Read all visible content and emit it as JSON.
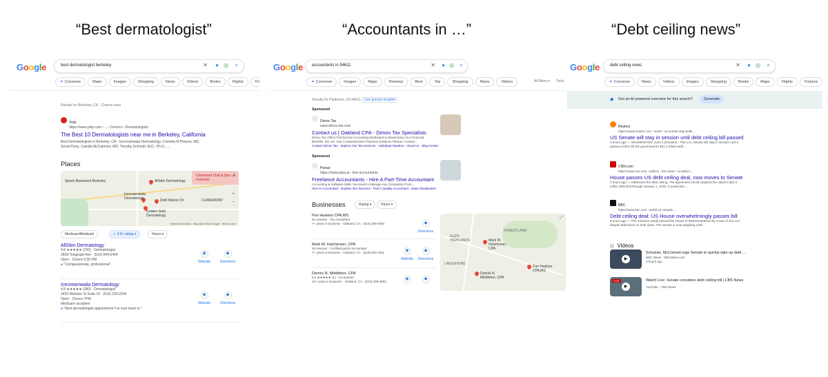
{
  "captions": [
    "“Best dermatologist”",
    "“Accountants in …”",
    "“Debt ceiling news”"
  ],
  "panel1": {
    "query": "best dermatologist berkeley",
    "chips": [
      "Converse",
      "Maps",
      "Images",
      "Shopping",
      "News",
      "Videos",
      "Books",
      "Flights",
      "Finance"
    ],
    "results_for": "Results for Berkeley, CA · Choose area",
    "yelp_source": "Yelp",
    "yelp_url": "https://www.yelp.com › ... › Doctors › Dermatologists",
    "yelp_title": "The Best 10 Dermatologists near me in Berkeley, California",
    "yelp_snippet1": "Best Dermatologists in Berkeley, CA - Icecreamwala Dermatology, Cornelia M Pessoa, MD,",
    "yelp_snippet2": "SevenThirty, Camilla McCalmont, MD, Timothy Schmidt, M.D., Ph.D., ...",
    "places_heading": "Places",
    "map_labels": [
      "AllSkin Dermatology",
      "Icecreamwala Dermatology",
      "Golden Gate Dermatology",
      "Dotti Warren Dr",
      "CLAREMONT",
      "Sports Basement Berkeley",
      "Claremont Club & Spa - A Fairmont"
    ],
    "map_footer": "Keyboard shortcuts · Map data ©2023 Google · Terms of Use",
    "filters": [
      "Medicare/Medicaid",
      "4.0+ rating",
      "Hours"
    ],
    "listings": [
      {
        "name": "AllSkin Dermatology",
        "rating": "4.8 ★★★★★ (242) · Dermatologist",
        "address": "2828 Telegraph Ave · (510) 849-6404",
        "hours": "Open · Closes 5:30 PM",
        "review": "\"Compassionate, professional\""
      },
      {
        "name": "Icecreamwala Dermatology",
        "rating": "4.8 ★★★★★ (380) · Dermatologist",
        "address": "2435 Webster St Suite 10 · (510) 330-2264",
        "hours": "Open · Closes 7PM",
        "extra": "Medicare accepted",
        "review": "\"Best dermatologist appointment I've ever been to.\""
      }
    ],
    "website": "Website",
    "directions": "Directions"
  },
  "panel2": {
    "query": "accountants in 94611",
    "chips": [
      "Converse",
      "Images",
      "Maps",
      "Reviews",
      "Best",
      "Top",
      "Shopping",
      "News",
      "Videos"
    ],
    "all_filters": "All filters ▾",
    "tools": "Tools",
    "results_for": "Results for Piedmont, CA 94611",
    "precise": "Use precise location",
    "ads": [
      {
        "sponsored": "Sponsored",
        "source": "Dimov Tax",
        "url": "www.dimov-tax.com",
        "title": "Contact us | Oakland CPA - Dimov Tax Specialists",
        "s1": "Dimov Tax Offers Full-Service Accounting Dedicated to Maximizing Your Financial",
        "s2": "Benefits. We Are Your Comprehensive Financial Solutions Partner. Contact...",
        "links": "Contact Dimov Tax · Explore Our Tax Services · Individual Taxation · About Us · Blog Center"
      },
      {
        "sponsored": "Sponsored",
        "source": "Paraul",
        "url": "https://www.para.ai › hire-accountants",
        "title": "Freelance Accountants - Hire A Part-Time Accountant",
        "s1": "Accounting & Software Skills You Need to Manage Any Complexity From...",
        "s2": "",
        "links": "Hire An Accountant · Explore Our Services · Find A Quality Accountant · Data Visualization"
      }
    ],
    "businesses_heading": "Businesses",
    "filters": [
      "Rating ▾",
      "Hours ▾"
    ],
    "businesses": [
      {
        "name": "Pan Haskins CPA,MS",
        "l1": "No reviews · Tax consultant",
        "l2": "7+ years in business · Oakland, CA · (510) 339-3000"
      },
      {
        "name": "Mark W. Hutchinson, CPA",
        "l1": "No reviews · Certified public accountant",
        "l2": "7+ years in business · Oakland, CA · (510) 653-7911"
      },
      {
        "name": "Dennis N. Middleton, CPA",
        "l1": "5.0 ★★★★★ (1) · Accountant",
        "l2": "10+ years in business · Oakland, CA · (510) 339-4863"
      }
    ],
    "map_labels": [
      "Mark W. Hutchinson, CPA",
      "Pan Haskins CPA,MS",
      "Dennis N. Middleton, CPA",
      "FORESTLAND",
      "GLEN HIGHLANDS",
      "LAKESHORE"
    ],
    "website": "Website",
    "directions": "Directions"
  },
  "panel3": {
    "query": "debt ceiling news",
    "chips": [
      "Converse",
      "News",
      "Videos",
      "Images",
      "Shopping",
      "Books",
      "Maps",
      "Flights",
      "Finance"
    ],
    "sge_prompt": "Get an AI-powered overview for this search?",
    "generate": "Generate",
    "news": [
      {
        "source": "Reuters",
        "url": "https://www.reuters.com › world › us-senate-stay-publi...",
        "title": "US Senate will stay in session until debt ceiling bill passed",
        "s1": "3 hours ago — WASHINGTON, June 1 (Reuters) - The U.S. Senate will stay in session until it",
        "s2": "passes a bill to lift the government's $31.4 trillion debt ..."
      },
      {
        "source": "CNN.com",
        "url": "https://www.cnn.com › politics › live-news › us-debt-c...",
        "title": "House passes US debt ceiling deal, now moves to Senate",
        "s1": "3 hours ago — Addresses the debt ceiling. The agreement would suspend the nation's $31.4",
        "s2": "trillion debt limit through January 1, 2025. It would also ..."
      },
      {
        "source": "BBC",
        "url": "https://www.bbc.com › world-us-canada-...",
        "title": "Debt ceiling deal: US House overwhelmingly passes bill",
        "s1": "6 hours ago — The measure easily passed the House of Representatives by a vote of 314-117,",
        "s2": "despite defections on both sides. The Senate is now weighing a bill ..."
      }
    ],
    "videos_heading": "Videos",
    "videos": [
      {
        "title": "Schumer, McConnell urge Senate to quickly take up debt ...",
        "source": "NBC News · NBCNews.com",
        "time": "3 hours ago"
      },
      {
        "title": "Watch Live: Senate considers debt ceiling bill | CBS News",
        "source": "YouTube · CBS News",
        "time": ""
      }
    ]
  },
  "logo": {
    "g1": "G",
    "o1": "o",
    "o2": "o",
    "g2": "g",
    "l": "l",
    "e": "e"
  },
  "colors": {
    "link": "#1a0dab",
    "accent": "#1a73e8",
    "pin": "#ea4335"
  }
}
